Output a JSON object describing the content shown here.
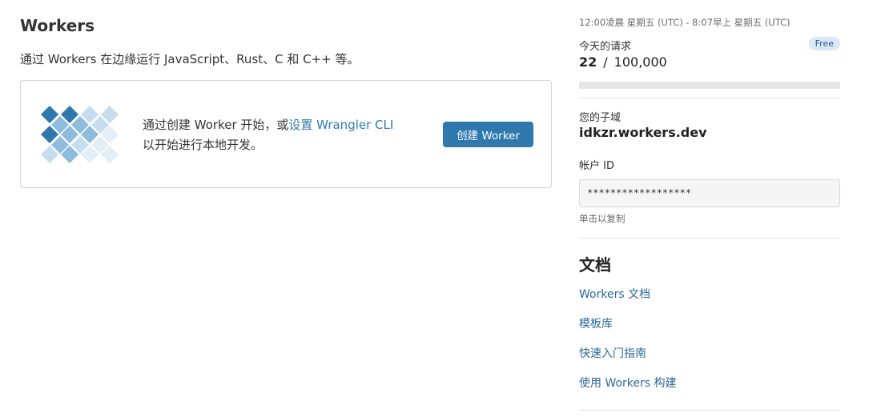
{
  "header": {
    "title": "Workers",
    "subtitle": "通过 Workers 在边缘运行 JavaScript、Rust、C 和 C++ 等。"
  },
  "intro_card": {
    "text_before": "通过创建 Worker 开始，或",
    "link_text": "设置 Wrangler CLI",
    "text_after": " 以开始进行本地开发。",
    "create_button_label": "创建 Worker"
  },
  "usage": {
    "time_range": "12:00凌晨 星期五 (UTC) - 8:07早上 星期五 (UTC)",
    "requests_label": "今天的请求",
    "plan_badge": "Free",
    "used": "22",
    "separator": "/",
    "limit": "100,000",
    "fraction_used": 0.00022
  },
  "account": {
    "subdomain_label": "您的子域",
    "subdomain": "idkzr.workers.dev",
    "account_id_label": "帐户 ID",
    "account_id_value": "******************",
    "copy_hint": "单击以复制"
  },
  "docs": {
    "heading": "文档",
    "links": [
      {
        "label": "Workers 文档"
      },
      {
        "label": "模板库"
      },
      {
        "label": "快速入门指南"
      },
      {
        "label": "使用 Workers 构建"
      }
    ]
  },
  "colors": {
    "accent": "#2f78ad",
    "link": "#2c6a99",
    "badge_bg": "#dbe8f5"
  }
}
